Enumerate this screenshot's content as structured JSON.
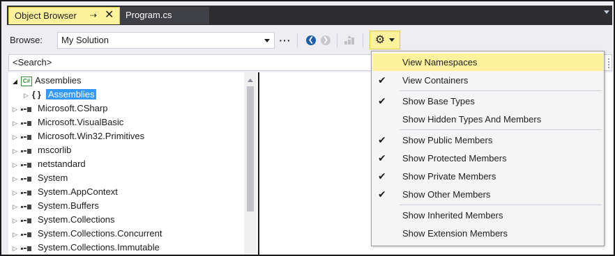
{
  "tabs": [
    {
      "label": "Object Browser",
      "pin_glyph": "⇢",
      "close_glyph": "✕"
    },
    {
      "label": "Program.cs"
    }
  ],
  "toolbar": {
    "browse_label": "Browse:",
    "browse_value": "My Solution",
    "more_glyph": "···"
  },
  "search": {
    "placeholder": "<Search>"
  },
  "tree": {
    "root": {
      "label": "Assemblies",
      "icon_text": "C#"
    },
    "child": {
      "label": "Assemblies",
      "icon_text": "{ }"
    },
    "items": [
      {
        "label": "Microsoft.CSharp"
      },
      {
        "label": "Microsoft.VisualBasic"
      },
      {
        "label": "Microsoft.Win32.Primitives"
      },
      {
        "label": "mscorlib"
      },
      {
        "label": "netstandard"
      },
      {
        "label": "System"
      },
      {
        "label": "System.AppContext"
      },
      {
        "label": "System.Buffers"
      },
      {
        "label": "System.Collections"
      },
      {
        "label": "System.Collections.Concurrent"
      },
      {
        "label": "System.Collections.Immutable"
      }
    ]
  },
  "menu": {
    "items": [
      {
        "label": "View Namespaces",
        "checked": false,
        "highlighted": true
      },
      {
        "label": "View Containers",
        "checked": true
      },
      {
        "label": "Show Base Types",
        "checked": true
      },
      {
        "label": "Show Hidden Types And Members",
        "checked": false
      },
      {
        "label": "Show Public Members",
        "checked": true
      },
      {
        "label": "Show Protected Members",
        "checked": true
      },
      {
        "label": "Show Private Members",
        "checked": true
      },
      {
        "label": "Show Other Members",
        "checked": true
      },
      {
        "label": "Show Inherited Members",
        "checked": false
      },
      {
        "label": "Show Extension Members",
        "checked": false
      }
    ],
    "check_glyph": "✔"
  },
  "colors": {
    "accent_yellow": "#fff29d",
    "tab_strip": "#2d2d30",
    "selection": "#3399ff",
    "nav_blue": "#1e5ea8"
  },
  "icons": {
    "settings": "gear-icon",
    "back": "back-arrow-icon",
    "forward": "forward-arrow-icon",
    "up": "up-level-icon",
    "assembly": "assembly-icon",
    "namespace": "namespace-icon"
  }
}
